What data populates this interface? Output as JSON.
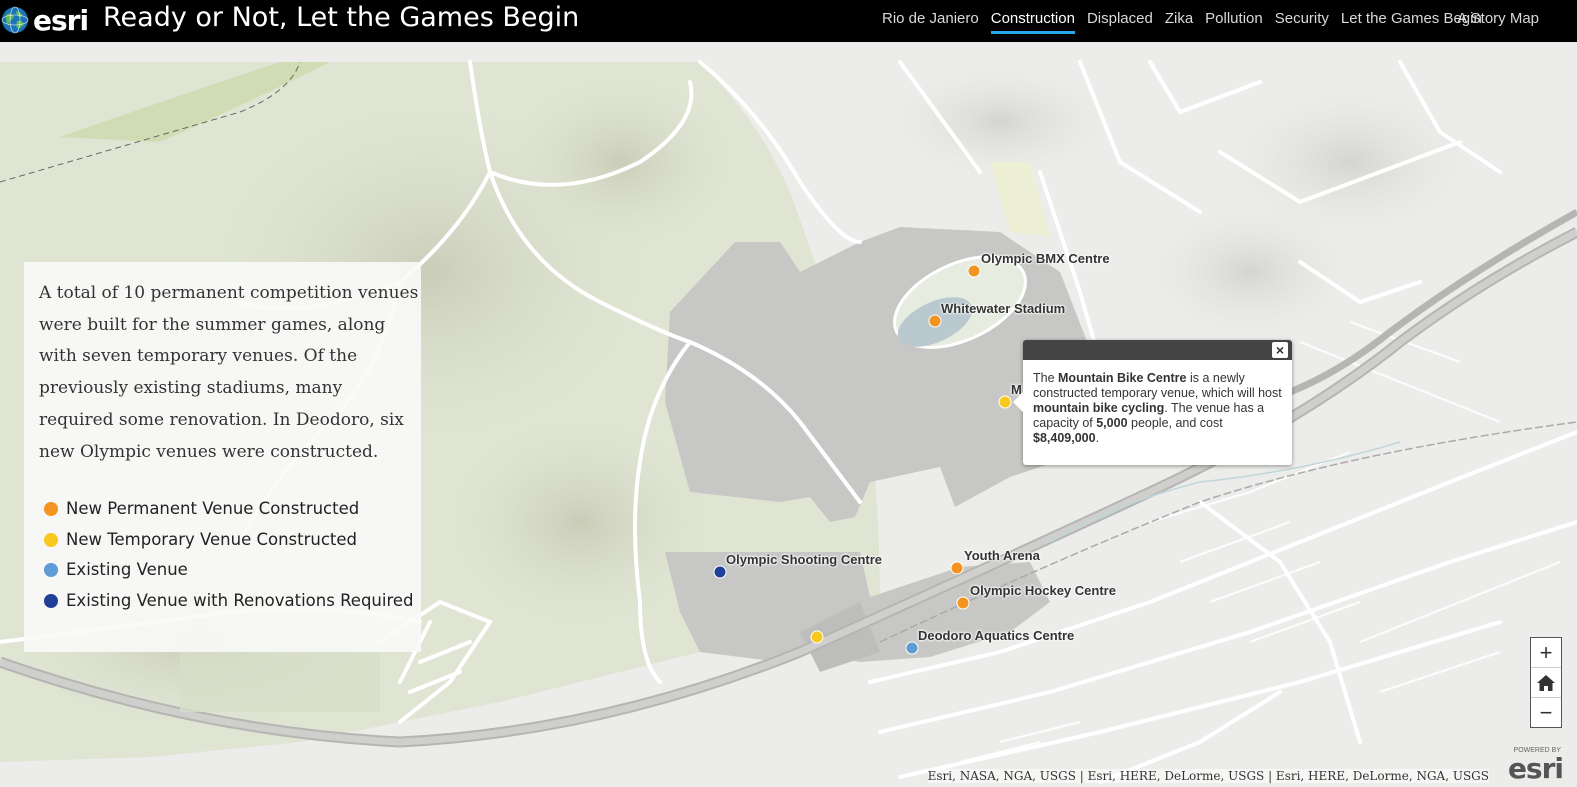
{
  "header": {
    "logo_text": "esri",
    "title": "Ready or Not, Let the Games Begin",
    "tabs": [
      {
        "label": "Rio de Janiero",
        "active": false
      },
      {
        "label": "Construction",
        "active": true
      },
      {
        "label": "Displaced",
        "active": false
      },
      {
        "label": "Zika",
        "active": false
      },
      {
        "label": "Pollution",
        "active": false
      },
      {
        "label": "Security",
        "active": false
      },
      {
        "label": "Let the Games Begin",
        "active": false
      }
    ],
    "story_link": "A Story Map",
    "accent_color": "#27a6e8"
  },
  "panel": {
    "text": "A total of 10 permanent competition venues were built for the summer games, along with seven temporary venues. Of the previously existing stadiums, many required some renovation. In Deodoro, six new Olympic venues were constructed.",
    "legend": [
      {
        "label": "New Permanent Venue Constructed",
        "color": "#f39320"
      },
      {
        "label": "New Temporary Venue Constructed",
        "color": "#f8c81f"
      },
      {
        "label": "Existing Venue",
        "color": "#5f9bd6"
      },
      {
        "label": "Existing Venue with Renovations Required",
        "color": "#1f3f98"
      }
    ]
  },
  "venues": [
    {
      "label": "Olympic BMX Centre",
      "category": "new-permanent"
    },
    {
      "label": "Whitewater Stadium",
      "category": "new-permanent"
    },
    {
      "label": "M",
      "category": "new-temporary"
    },
    {
      "label": "Olympic Shooting Centre",
      "category": "existing-renovated"
    },
    {
      "label": "Youth Arena",
      "category": "new-permanent"
    },
    {
      "label": "Olympic Hockey Centre",
      "category": "new-permanent"
    },
    {
      "label": "",
      "category": "new-temporary"
    },
    {
      "label": "Deodoro Aquatics Centre",
      "category": "existing"
    }
  ],
  "popup": {
    "close_label": "×",
    "pre1": "The ",
    "name": "Mountain Bike Centre",
    "mid1": " is a newly constructed temporary venue, which will host ",
    "sport": "mountain bike cycling",
    "mid2": ". The venue has a capacity of ",
    "capacity": "5,000",
    "mid3": " people, and cost ",
    "cost": "$8,409,000",
    "end": "."
  },
  "zoom": {
    "in": "+",
    "home_icon": "home-icon",
    "out": "−"
  },
  "attribution": "Esri, NASA, NGA, USGS | Esri, HERE, DeLorme, USGS | Esri, HERE, DeLorme, NGA, USGS",
  "powered_by": {
    "text": "POWERED BY",
    "logo": "esri"
  }
}
